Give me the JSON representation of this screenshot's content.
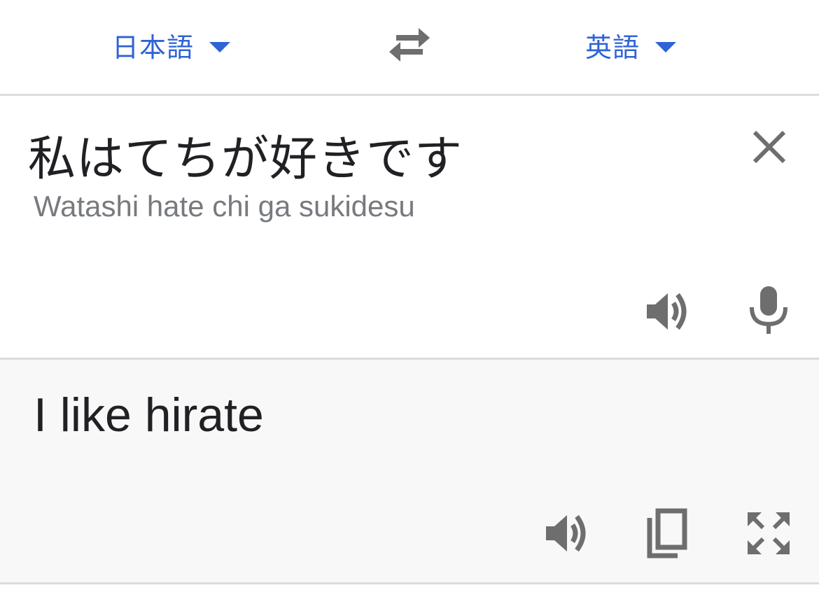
{
  "header": {
    "source_language": "日本語",
    "target_language": "英語"
  },
  "source": {
    "text": "私はてちが好きです",
    "romanization": "Watashi hate chi ga sukidesu"
  },
  "result": {
    "text": "I like hirate"
  },
  "icons": {
    "source_caret": "chevron-down-icon",
    "target_caret": "chevron-down-icon",
    "swap": "swap-horizontal-icon",
    "clear": "close-icon",
    "source_speak": "speaker-icon",
    "microphone": "microphone-icon",
    "result_speak": "speaker-icon",
    "copy": "copy-icon",
    "fullscreen": "fullscreen-icon"
  },
  "colors": {
    "accent": "#2f63d6",
    "icon_gray": "#6e6e6e",
    "text_primary": "#202124",
    "text_secondary": "#777a7e",
    "divider": "#dadce0",
    "result_background": "#f8f8f8"
  }
}
